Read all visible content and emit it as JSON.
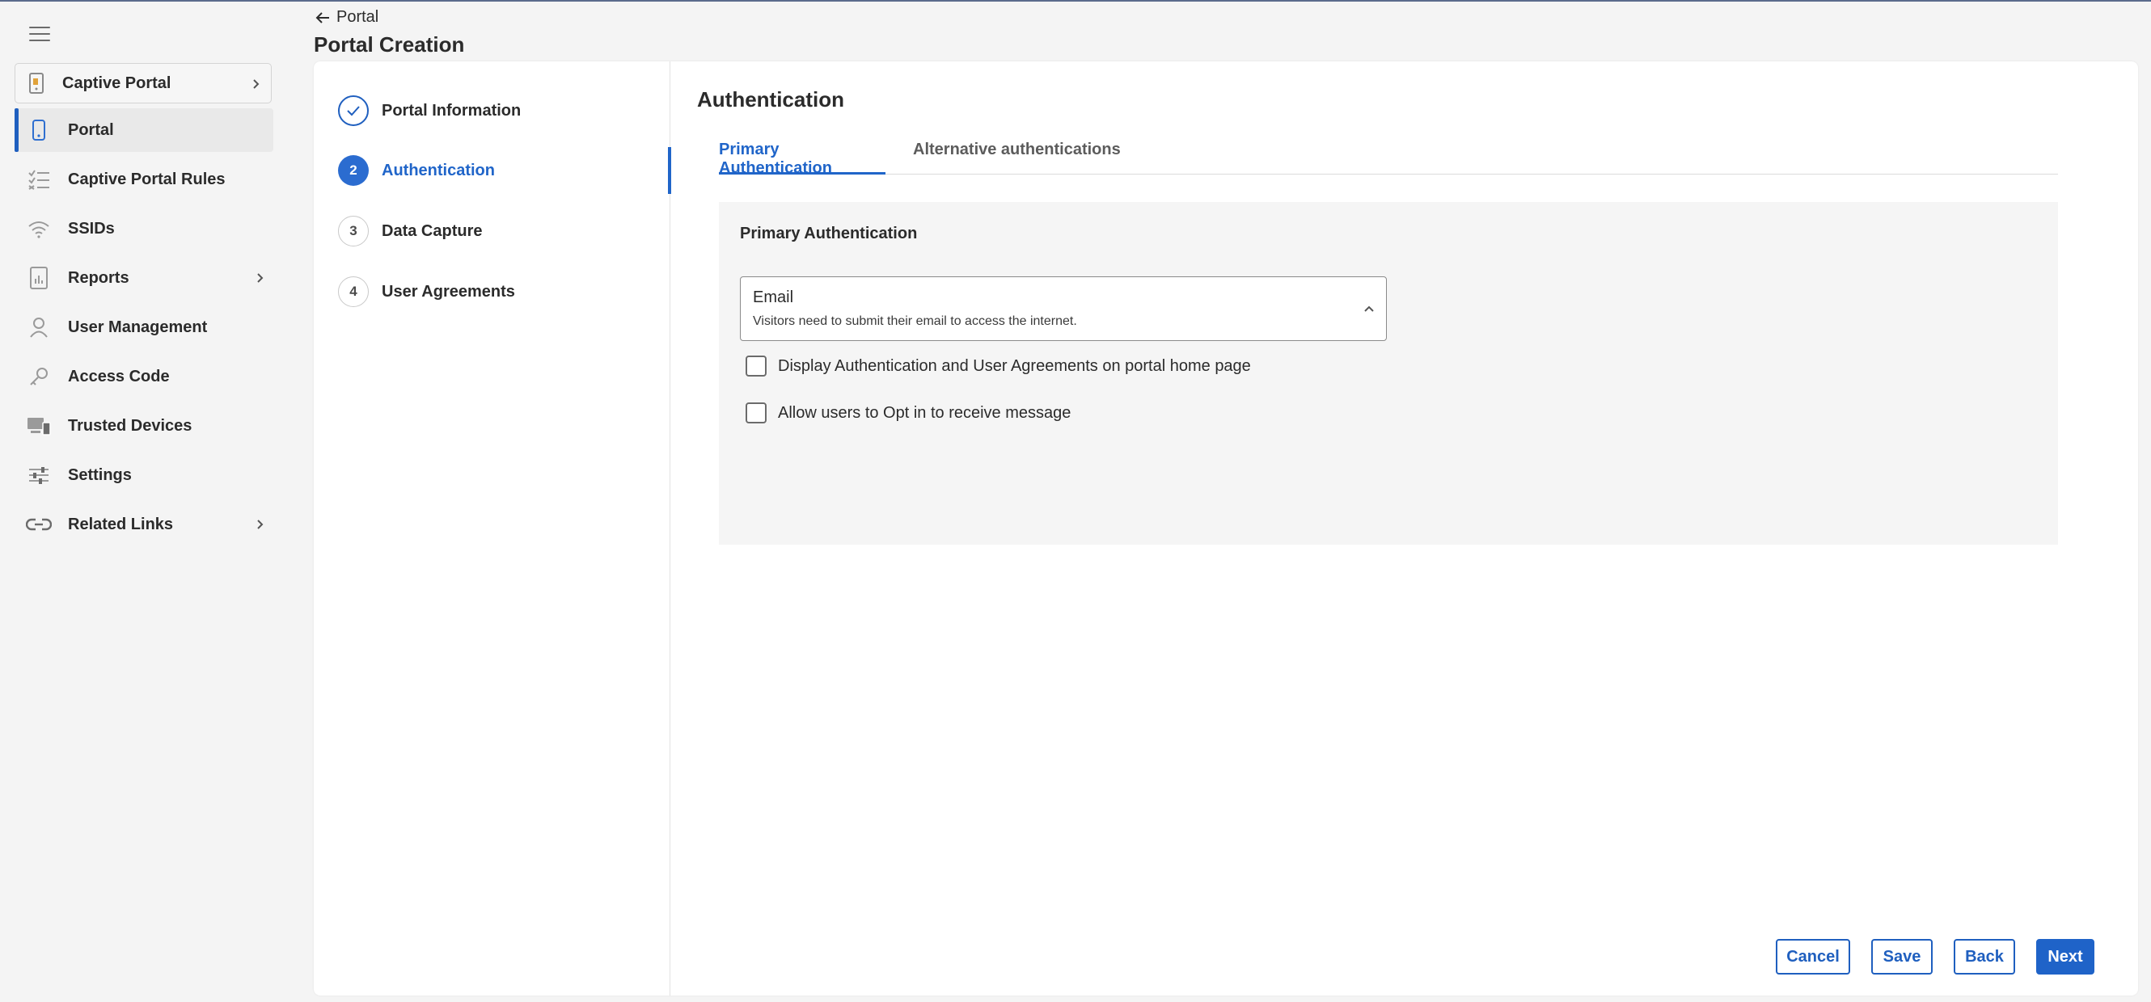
{
  "sidebar": {
    "app_switcher_label": "Captive Portal",
    "items": [
      {
        "label": "Portal",
        "icon": "phone-icon",
        "active": true,
        "has_children": false
      },
      {
        "label": "Captive Portal Rules",
        "icon": "checklist-icon",
        "active": false,
        "has_children": false
      },
      {
        "label": "SSIDs",
        "icon": "wifi-icon",
        "active": false,
        "has_children": false
      },
      {
        "label": "Reports",
        "icon": "report-icon",
        "active": false,
        "has_children": true
      },
      {
        "label": "User Management",
        "icon": "user-icon",
        "active": false,
        "has_children": false
      },
      {
        "label": "Access Code",
        "icon": "key-icon",
        "active": false,
        "has_children": false
      },
      {
        "label": "Trusted Devices",
        "icon": "devices-icon",
        "active": false,
        "has_children": false
      },
      {
        "label": "Settings",
        "icon": "sliders-icon",
        "active": false,
        "has_children": false
      },
      {
        "label": "Related Links",
        "icon": "link-icon",
        "active": false,
        "has_children": true
      }
    ]
  },
  "header": {
    "breadcrumb": "Portal",
    "title": "Portal Creation"
  },
  "stepper": {
    "steps": [
      {
        "number": "",
        "label": "Portal Information",
        "state": "done"
      },
      {
        "number": "2",
        "label": "Authentication",
        "state": "current"
      },
      {
        "number": "3",
        "label": "Data Capture",
        "state": "pending"
      },
      {
        "number": "4",
        "label": "User Agreements",
        "state": "pending"
      }
    ]
  },
  "main": {
    "section_title": "Authentication",
    "tabs": [
      {
        "label": "Primary Authentication",
        "active": true
      },
      {
        "label": "Alternative authentications",
        "active": false
      }
    ],
    "panel_title": "Primary Authentication",
    "auth_select": {
      "value": "Email",
      "description": "Visitors need to submit their email to access the internet."
    },
    "checkboxes": [
      {
        "label": "Display Authentication and User Agreements on portal home page",
        "checked": false
      },
      {
        "label": "Allow users to Opt in to receive message",
        "checked": false
      }
    ]
  },
  "footer": {
    "cancel": "Cancel",
    "save": "Save",
    "back": "Back",
    "next": "Next"
  },
  "colors": {
    "accent": "#1f5fbf",
    "background": "#f4f4f4",
    "panel": "#f5f5f5"
  }
}
